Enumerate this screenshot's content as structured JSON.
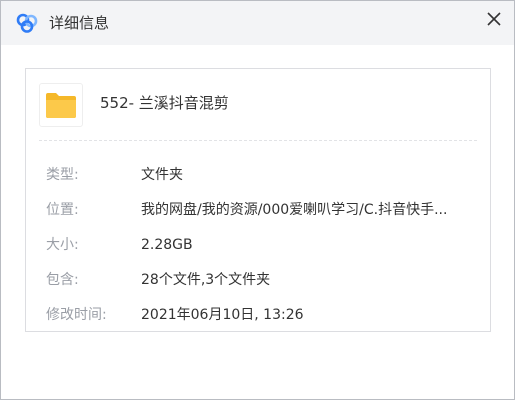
{
  "window": {
    "title": "详细信息",
    "icon": "baidu-netdisk-logo-icon",
    "close_icon": "close-icon"
  },
  "item": {
    "icon": "folder-icon",
    "name": "552- 兰溪抖音混剪"
  },
  "details": [
    {
      "label": "类型:",
      "value": "文件夹"
    },
    {
      "label": "位置:",
      "value": "我的网盘/我的资源/000爱喇叭学习/C.抖音快手..."
    },
    {
      "label": "大小:",
      "value": "2.28GB"
    },
    {
      "label": "包含:",
      "value": "28个文件,3个文件夹"
    },
    {
      "label": "修改时间:",
      "value": "2021年06月10日, 13:26"
    }
  ],
  "colors": {
    "folder": "#fcc94a",
    "logo_blue": "#2f7cf6",
    "logo_light": "#7fb7ff"
  }
}
